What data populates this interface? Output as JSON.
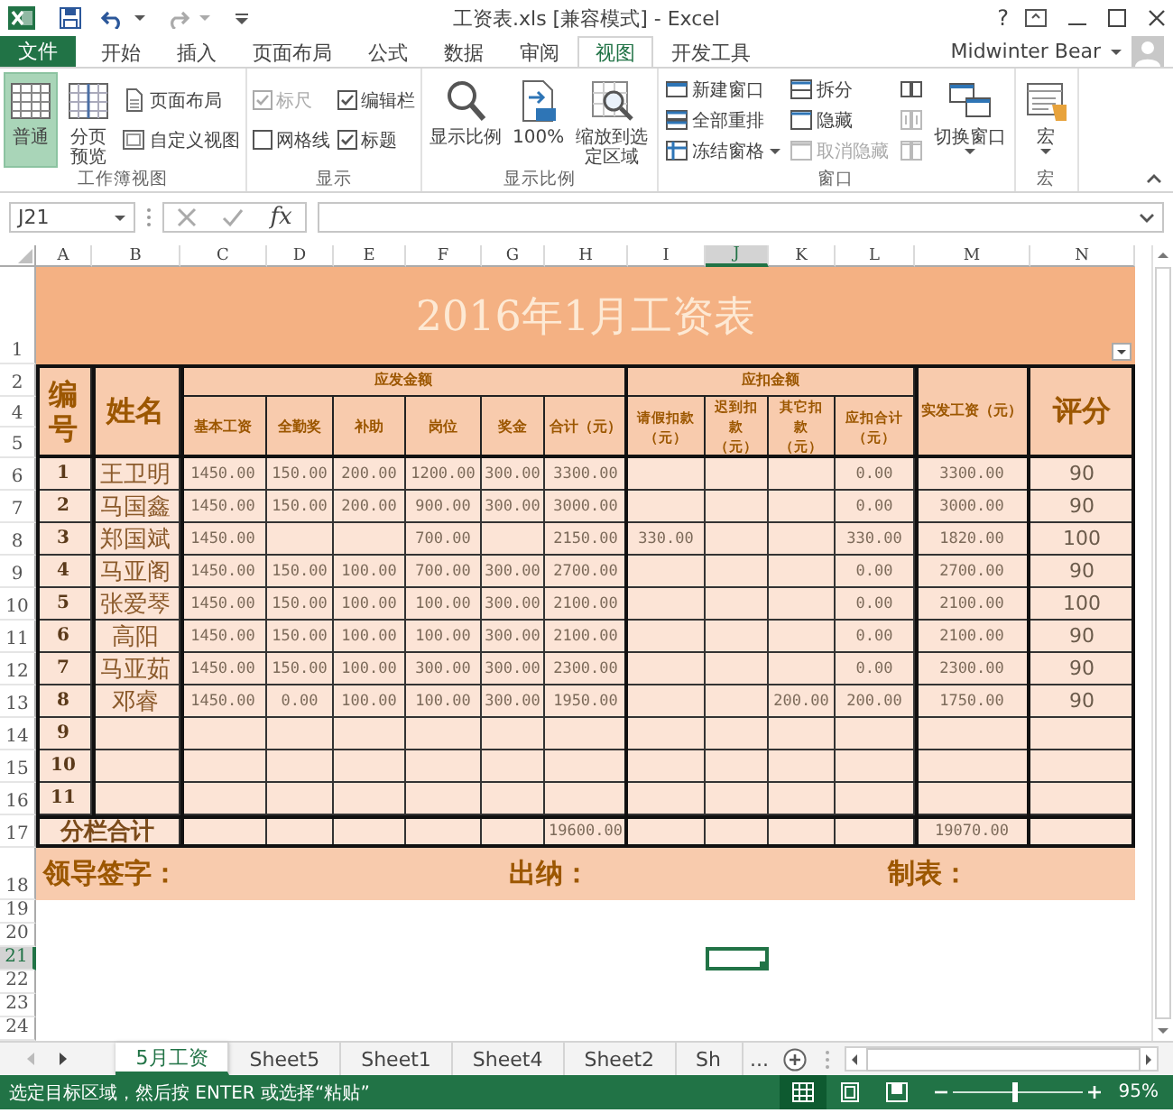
{
  "title_bar": {
    "title": "工资表.xls  [兼容模式] - Excel",
    "help": "?"
  },
  "ribbon_tabs": {
    "file": "文件",
    "tabs": [
      {
        "label": "开始",
        "selected": false
      },
      {
        "label": "插入",
        "selected": false
      },
      {
        "label": "页面布局",
        "selected": false
      },
      {
        "label": "公式",
        "selected": false
      },
      {
        "label": "数据",
        "selected": false
      },
      {
        "label": "审阅",
        "selected": false
      },
      {
        "label": "视图",
        "selected": true
      },
      {
        "label": "开发工具",
        "selected": false
      }
    ],
    "account": "Midwinter Bear"
  },
  "ribbon": {
    "groups": [
      {
        "label": "工作簿视图",
        "items": [
          {
            "kind": "large",
            "label": "普通",
            "selected": true
          },
          {
            "kind": "large",
            "label": "分页预览",
            "selected": false
          },
          {
            "kind": "column",
            "items": [
              {
                "kind": "small",
                "label": "页面布局"
              },
              {
                "kind": "small",
                "label": "自定义视图"
              }
            ]
          }
        ]
      },
      {
        "label": "显示",
        "items": [
          {
            "kind": "column",
            "items": [
              {
                "kind": "check",
                "label": "标尺",
                "checked": true,
                "disabled": true
              },
              {
                "kind": "check",
                "label": "网格线",
                "checked": false,
                "disabled": false
              }
            ]
          },
          {
            "kind": "column",
            "items": [
              {
                "kind": "check",
                "label": "编辑栏",
                "checked": true,
                "disabled": false
              },
              {
                "kind": "check",
                "label": "标题",
                "checked": true,
                "disabled": false
              }
            ]
          }
        ]
      },
      {
        "label": "显示比例",
        "items": [
          {
            "kind": "large",
            "label": "显示比例"
          },
          {
            "kind": "large",
            "label": "100%"
          },
          {
            "kind": "large",
            "label": "缩放到选定区域"
          }
        ]
      },
      {
        "label": "窗口",
        "items": [
          {
            "kind": "column",
            "items": [
              {
                "kind": "small",
                "label": "新建窗口"
              },
              {
                "kind": "small",
                "label": "全部重排"
              },
              {
                "kind": "small",
                "label": "冻结窗格",
                "dropdown": true
              }
            ]
          },
          {
            "kind": "column",
            "items": [
              {
                "kind": "small",
                "label": "拆分",
                "disabled": false
              },
              {
                "kind": "small",
                "label": "隐藏",
                "disabled": false
              },
              {
                "kind": "small",
                "label": "取消隐藏",
                "disabled": true
              }
            ]
          },
          {
            "kind": "column",
            "items": [
              {
                "kind": "icon",
                "disabled": false
              },
              {
                "kind": "icon",
                "disabled": true
              },
              {
                "kind": "icon",
                "disabled": true
              }
            ]
          },
          {
            "kind": "large",
            "label": "切换窗口",
            "dropdown": true
          }
        ]
      },
      {
        "label": "宏",
        "items": [
          {
            "kind": "large",
            "label": "宏",
            "dropdown": true
          }
        ]
      }
    ]
  },
  "formula_bar": {
    "name_box": "J21",
    "function_button": "fx"
  },
  "sheet": {
    "columns": [
      {
        "label": "A",
        "selected": false
      },
      {
        "label": "B",
        "selected": false
      },
      {
        "label": "C",
        "selected": false
      },
      {
        "label": "D",
        "selected": false
      },
      {
        "label": "E",
        "selected": false
      },
      {
        "label": "F",
        "selected": false
      },
      {
        "label": "G",
        "selected": false
      },
      {
        "label": "H",
        "selected": false
      },
      {
        "label": "I",
        "selected": false
      },
      {
        "label": "J",
        "selected": true
      },
      {
        "label": "K",
        "selected": false
      },
      {
        "label": "L",
        "selected": false
      },
      {
        "label": "M",
        "selected": false
      },
      {
        "label": "N",
        "selected": false
      }
    ],
    "rows": [
      {
        "label": "1",
        "selected": false
      },
      {
        "label": "2",
        "selected": false
      },
      {
        "label": "4",
        "selected": false
      },
      {
        "label": "5",
        "selected": false
      },
      {
        "label": "6",
        "selected": false
      },
      {
        "label": "7",
        "selected": false
      },
      {
        "label": "8",
        "selected": false
      },
      {
        "label": "9",
        "selected": false
      },
      {
        "label": "10",
        "selected": false
      },
      {
        "label": "11",
        "selected": false
      },
      {
        "label": "12",
        "selected": false
      },
      {
        "label": "13",
        "selected": false
      },
      {
        "label": "14",
        "selected": false
      },
      {
        "label": "15",
        "selected": false
      },
      {
        "label": "16",
        "selected": false
      },
      {
        "label": "17",
        "selected": false
      },
      {
        "label": "18",
        "selected": false
      },
      {
        "label": "19",
        "selected": false
      },
      {
        "label": "20",
        "selected": false
      },
      {
        "label": "21",
        "selected": true
      },
      {
        "label": "22",
        "selected": false
      },
      {
        "label": "23",
        "selected": false
      },
      {
        "label": "24",
        "selected": false
      }
    ],
    "title": "2016年1月工资表",
    "header": {
      "number": "编号",
      "name": "姓名",
      "payable": "应发金额",
      "payable_columns": [
        "基本工资",
        "全勤奖",
        "补助",
        "岗位",
        "奖金",
        "合计（元）"
      ],
      "deductions": "应扣金额",
      "deduction_columns": [
        "请假扣款（元）",
        "迟到扣款（元）",
        "其它扣款（元）",
        "应扣合计（元）"
      ],
      "net_pay": "实发工资（元）",
      "score": "评分"
    },
    "records": [
      {
        "number": "1",
        "name": "王卫明",
        "values": {
          "base_pay": "1450.00",
          "attendance_bonus": "150.00",
          "allowance": "200.00",
          "position_pay": "1200.00",
          "bonus": "300.00",
          "gross_total": "3300.00",
          "deduction_total": "0.00",
          "net_pay": "3300.00",
          "score": "90"
        }
      },
      {
        "number": "2",
        "name": "马国鑫",
        "values": {
          "base_pay": "1450.00",
          "attendance_bonus": "150.00",
          "allowance": "200.00",
          "position_pay": "900.00",
          "bonus": "300.00",
          "gross_total": "3000.00",
          "deduction_total": "0.00",
          "net_pay": "3000.00",
          "score": "90"
        }
      },
      {
        "number": "3",
        "name": "郑国斌",
        "values": {
          "base_pay": "1450.00",
          "position_pay": "700.00",
          "gross_total": "2150.00",
          "leave_deduction": "330.00",
          "deduction_total": "330.00",
          "net_pay": "1820.00",
          "score": "100"
        }
      },
      {
        "number": "4",
        "name": "马亚阁",
        "values": {
          "base_pay": "1450.00",
          "attendance_bonus": "150.00",
          "allowance": "100.00",
          "position_pay": "700.00",
          "bonus": "300.00",
          "gross_total": "2700.00",
          "deduction_total": "0.00",
          "net_pay": "2700.00",
          "score": "90"
        }
      },
      {
        "number": "5",
        "name": "张爱琴",
        "values": {
          "base_pay": "1450.00",
          "attendance_bonus": "150.00",
          "allowance": "100.00",
          "position_pay": "100.00",
          "bonus": "300.00",
          "gross_total": "2100.00",
          "deduction_total": "0.00",
          "net_pay": "2100.00",
          "score": "100"
        }
      },
      {
        "number": "6",
        "name": "高阳",
        "values": {
          "base_pay": "1450.00",
          "attendance_bonus": "150.00",
          "allowance": "100.00",
          "position_pay": "100.00",
          "bonus": "300.00",
          "gross_total": "2100.00",
          "deduction_total": "0.00",
          "net_pay": "2100.00",
          "score": "90"
        }
      },
      {
        "number": "7",
        "name": "马亚茹",
        "values": {
          "base_pay": "1450.00",
          "attendance_bonus": "150.00",
          "allowance": "100.00",
          "position_pay": "300.00",
          "bonus": "300.00",
          "gross_total": "2300.00",
          "deduction_total": "0.00",
          "net_pay": "2300.00",
          "score": "90"
        }
      },
      {
        "number": "8",
        "name": "邓睿",
        "values": {
          "base_pay": "1450.00",
          "attendance_bonus": "0.00",
          "allowance": "100.00",
          "position_pay": "100.00",
          "bonus": "300.00",
          "gross_total": "1950.00",
          "other_deduction": "200.00",
          "deduction_total": "200.00",
          "net_pay": "1750.00",
          "score": "90"
        }
      },
      {
        "number": "9"
      },
      {
        "number": "10"
      },
      {
        "number": "11"
      }
    ],
    "totals": {
      "label": "分栏合计",
      "values": {
        "gross_total": "19600.00",
        "net_pay": "19070.00"
      }
    },
    "signatures": [
      "领导签字：",
      "出纳：",
      "制表："
    ]
  },
  "sheet_tabs": {
    "tabs": [
      {
        "label": "5月工资",
        "selected": true
      },
      {
        "label": "Sheet5",
        "selected": false
      },
      {
        "label": "Sheet1",
        "selected": false
      },
      {
        "label": "Sheet4",
        "selected": false
      },
      {
        "label": "Sheet2",
        "selected": false
      },
      {
        "label": "Sh",
        "selected": false
      }
    ],
    "more": "..."
  },
  "status_bar": {
    "message": "选定目标区域，然后按 ENTER 或选择“粘贴”",
    "view_buttons": [
      {
        "selected": true
      },
      {
        "selected": false
      },
      {
        "selected": false
      }
    ],
    "zoom": {
      "level": 0.47
    },
    "zoom_label": "95%"
  }
}
